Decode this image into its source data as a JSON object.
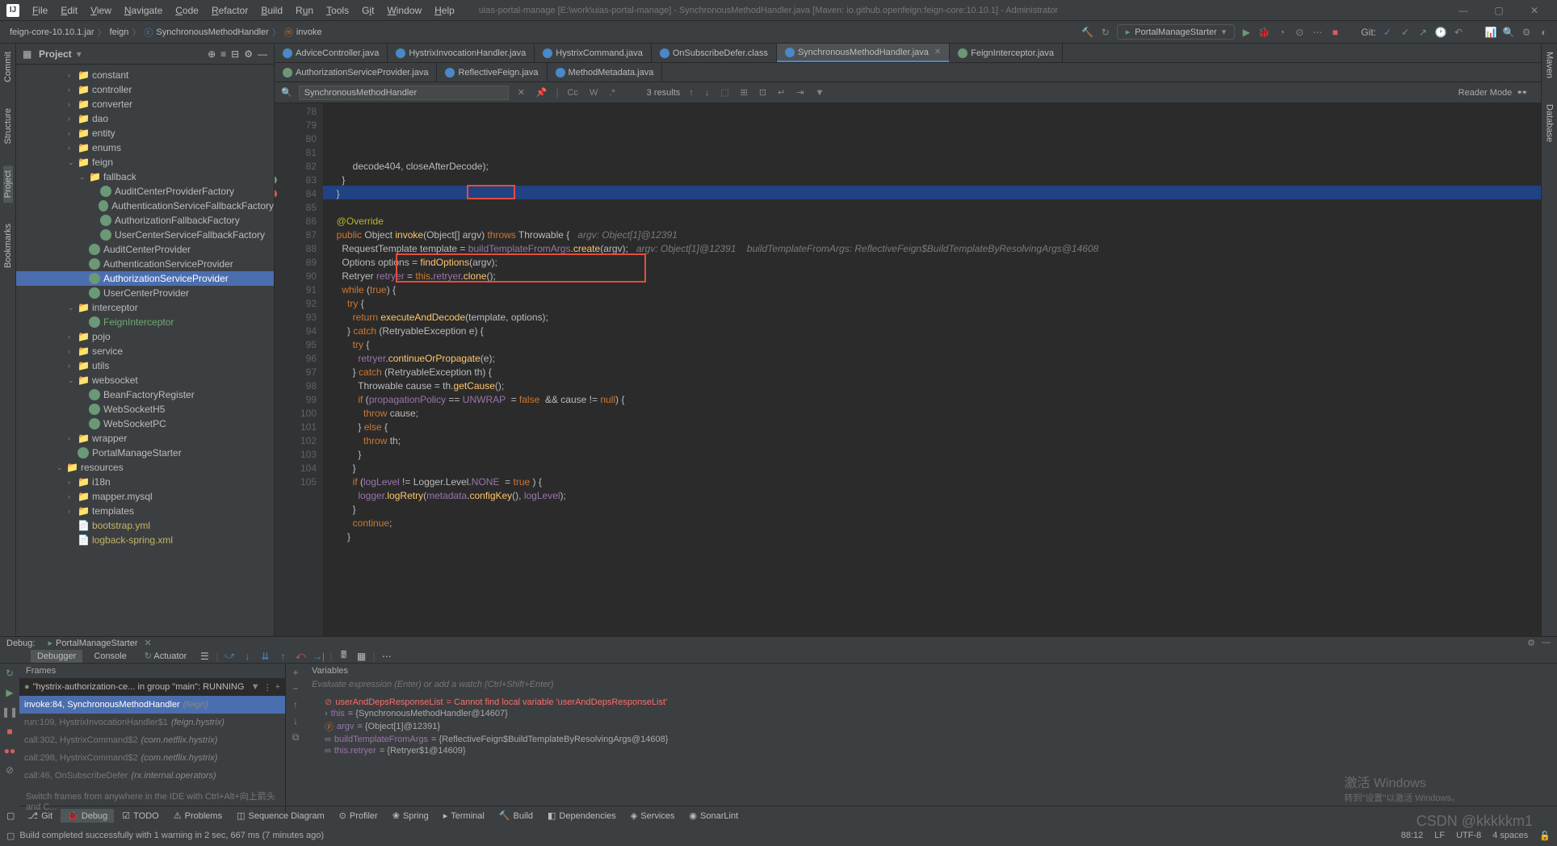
{
  "menubar": {
    "items": [
      "File",
      "Edit",
      "View",
      "Navigate",
      "Code",
      "Refactor",
      "Build",
      "Run",
      "Tools",
      "Git",
      "Window",
      "Help"
    ],
    "title": "uias-portal-manage [E:\\work\\uias-portal-manage] - SynchronousMethodHandler.java [Maven: io.github.openfeign:feign-core:10.10.1] - Administrator"
  },
  "navbar": {
    "crumbs": [
      "feign-core-10.10.1.jar",
      "feign",
      "SynchronousMethodHandler",
      "invoke"
    ],
    "runConfig": "PortalManageStarter",
    "gitLabel": "Git:"
  },
  "projectPanel": {
    "title": "Project",
    "tree": [
      {
        "d": 4,
        "a": ">",
        "i": "pkg",
        "l": "constant"
      },
      {
        "d": 4,
        "a": ">",
        "i": "pkg",
        "l": "controller"
      },
      {
        "d": 4,
        "a": ">",
        "i": "pkg",
        "l": "converter"
      },
      {
        "d": 4,
        "a": ">",
        "i": "pkg",
        "l": "dao"
      },
      {
        "d": 4,
        "a": ">",
        "i": "pkg",
        "l": "entity"
      },
      {
        "d": 4,
        "a": ">",
        "i": "pkg",
        "l": "enums"
      },
      {
        "d": 4,
        "a": "v",
        "i": "pkg",
        "l": "feign"
      },
      {
        "d": 5,
        "a": "v",
        "i": "pkg",
        "l": "fallback"
      },
      {
        "d": 6,
        "a": "",
        "i": "cls",
        "l": "AuditCenterProviderFactory"
      },
      {
        "d": 6,
        "a": "",
        "i": "cls",
        "l": "AuthenticationServiceFallbackFactory"
      },
      {
        "d": 6,
        "a": "",
        "i": "cls",
        "l": "AuthorizationFallbackFactory"
      },
      {
        "d": 6,
        "a": "",
        "i": "cls",
        "l": "UserCenterServiceFallbackFactory"
      },
      {
        "d": 5,
        "a": "",
        "i": "prov",
        "l": "AuditCenterProvider"
      },
      {
        "d": 5,
        "a": "",
        "i": "prov",
        "l": "AuthenticationServiceProvider"
      },
      {
        "d": 5,
        "a": "",
        "i": "prov",
        "l": "AuthorizationServiceProvider",
        "sel": true
      },
      {
        "d": 5,
        "a": "",
        "i": "prov",
        "l": "UserCenterProvider"
      },
      {
        "d": 4,
        "a": "v",
        "i": "pkg",
        "l": "interceptor"
      },
      {
        "d": 5,
        "a": "",
        "i": "cls",
        "l": "FeignInterceptor",
        "cls": "green"
      },
      {
        "d": 4,
        "a": ">",
        "i": "pkg",
        "l": "pojo"
      },
      {
        "d": 4,
        "a": ">",
        "i": "pkg",
        "l": "service"
      },
      {
        "d": 4,
        "a": ">",
        "i": "pkg",
        "l": "utils"
      },
      {
        "d": 4,
        "a": "v",
        "i": "pkg",
        "l": "websocket"
      },
      {
        "d": 5,
        "a": "",
        "i": "cls",
        "l": "BeanFactoryRegister"
      },
      {
        "d": 5,
        "a": "",
        "i": "cls",
        "l": "WebSocketH5"
      },
      {
        "d": 5,
        "a": "",
        "i": "cls",
        "l": "WebSocketPC"
      },
      {
        "d": 4,
        "a": ">",
        "i": "pkg",
        "l": "wrapper"
      },
      {
        "d": 4,
        "a": "",
        "i": "cls",
        "l": "PortalManageStarter"
      },
      {
        "d": 3,
        "a": "v",
        "i": "pkg",
        "l": "resources"
      },
      {
        "d": 4,
        "a": ">",
        "i": "pkg",
        "l": "i18n"
      },
      {
        "d": 4,
        "a": ">",
        "i": "pkg",
        "l": "mapper.mysql"
      },
      {
        "d": 4,
        "a": ">",
        "i": "pkg",
        "l": "templates"
      },
      {
        "d": 4,
        "a": "",
        "i": "file",
        "l": "bootstrap.yml",
        "cls": "yellow"
      },
      {
        "d": 4,
        "a": "",
        "i": "file",
        "l": "logback-spring.xml",
        "cls": "yellow"
      }
    ]
  },
  "editor": {
    "tabs1": [
      {
        "l": "AdviceController.java",
        "i": "b"
      },
      {
        "l": "HystrixInvocationHandler.java",
        "i": "b"
      },
      {
        "l": "HystrixCommand.java",
        "i": "b"
      },
      {
        "l": "OnSubscribeDefer.class",
        "i": "b"
      },
      {
        "l": "SynchronousMethodHandler.java",
        "i": "b",
        "active": true,
        "close": true
      },
      {
        "l": "FeignInterceptor.java",
        "i": "g"
      }
    ],
    "tabs2": [
      {
        "l": "AuthorizationServiceProvider.java",
        "i": "g"
      },
      {
        "l": "ReflectiveFeign.java",
        "i": "b"
      },
      {
        "l": "MethodMetadata.java",
        "i": "b"
      }
    ],
    "search": {
      "query": "SynchronousMethodHandler",
      "results": "3 results"
    },
    "readerMode": "Reader Mode",
    "code": {
      "start": 78,
      "lines": [
        {
          "n": 78,
          "t": "        decode404, closeAfterDecode);"
        },
        {
          "n": 79,
          "t": "    }"
        },
        {
          "n": 80,
          "t": "  }"
        },
        {
          "n": 81,
          "t": ""
        },
        {
          "n": 82,
          "t": "  @Override",
          "ann": true
        },
        {
          "n": 83,
          "t": "  public Object invoke(Object[] argv) throws Throwable {",
          "hint": "argv: Object[1]@12391",
          "ov": true
        },
        {
          "n": 84,
          "t": "    RequestTemplate template = buildTemplateFromArgs.create(argv);",
          "hint": "argv: Object[1]@12391    buildTemplateFromArgs: ReflectiveFeign$BuildTemplateByResolvingArgs@14608",
          "hl": true,
          "bp": true
        },
        {
          "n": 85,
          "t": "    Options options = findOptions(argv);"
        },
        {
          "n": 86,
          "t": "    Retryer retryer = this.retryer.clone();"
        },
        {
          "n": 87,
          "t": "    while (true) {"
        },
        {
          "n": 88,
          "t": "      try {"
        },
        {
          "n": 89,
          "t": "        return executeAndDecode(template, options);"
        },
        {
          "n": 90,
          "t": "      } catch (RetryableException e) {"
        },
        {
          "n": 91,
          "t": "        try {"
        },
        {
          "n": 92,
          "t": "          retryer.continueOrPropagate(e);"
        },
        {
          "n": 93,
          "t": "        } catch (RetryableException th) {"
        },
        {
          "n": 94,
          "t": "          Throwable cause = th.getCause();"
        },
        {
          "n": 95,
          "t": "          if (propagationPolicy == UNWRAP  = false  && cause != null) {"
        },
        {
          "n": 96,
          "t": "            throw cause;"
        },
        {
          "n": 97,
          "t": "          } else {"
        },
        {
          "n": 98,
          "t": "            throw th;"
        },
        {
          "n": 99,
          "t": "          }"
        },
        {
          "n": 100,
          "t": "        }"
        },
        {
          "n": 101,
          "t": "        if (logLevel != Logger.Level.NONE  = true ) {"
        },
        {
          "n": 102,
          "t": "          logger.logRetry(metadata.configKey(), logLevel);"
        },
        {
          "n": 103,
          "t": "        }"
        },
        {
          "n": 104,
          "t": "        continue;"
        },
        {
          "n": 105,
          "t": "      }"
        }
      ]
    }
  },
  "debug": {
    "header": "Debug:",
    "tab": "PortalManageStarter",
    "tabs": [
      "Debugger",
      "Console",
      "Actuator"
    ],
    "framesHdr": "Frames",
    "varsHdr": "Variables",
    "thread": "\"hystrix-authorization-ce... in group \"main\": RUNNING",
    "frames": [
      {
        "l": "invoke:84, SynchronousMethodHandler",
        "it": "(feign)",
        "sel": true
      },
      {
        "l": "run:109, HystrixInvocationHandler$1",
        "it": "(feign.hystrix)"
      },
      {
        "l": "call:302, HystrixCommand$2",
        "it": "(com.netflix.hystrix)"
      },
      {
        "l": "call:298, HystrixCommand$2",
        "it": "(com.netflix.hystrix)"
      },
      {
        "l": "call:46, OnSubscribeDefer",
        "it": "(rx.internal.operators)"
      }
    ],
    "framesHint": "Switch frames from anywhere in the IDE with Ctrl+Alt+向上箭头 and C...",
    "evalPlaceholder": "Evaluate expression (Enter) or add a watch (Ctrl+Shift+Enter)",
    "vars": [
      {
        "ico": "!",
        "n": "userAndDepsResponseList",
        "v": "= Cannot find local variable 'userAndDepsResponseList'",
        "err": true
      },
      {
        "ico": ">",
        "n": "this",
        "v": "= {SynchronousMethodHandler@14607}"
      },
      {
        "ico": ">",
        "n": "argv",
        "v": "= {Object[1]@12391}",
        "p": true
      },
      {
        "ico": ">",
        "n": "buildTemplateFromArgs",
        "v": "= {ReflectiveFeign$BuildTemplateByResolvingArgs@14608}",
        "oo": true
      },
      {
        "ico": ">",
        "n": "this.retryer",
        "v": "= {Retryer$1@14609}",
        "oo": true
      }
    ]
  },
  "toolWindows": [
    {
      "l": "Git",
      "i": "⎇"
    },
    {
      "l": "Debug",
      "i": "🐞",
      "active": true
    },
    {
      "l": "TODO",
      "i": "☑"
    },
    {
      "l": "Problems",
      "i": "⚠"
    },
    {
      "l": "Sequence Diagram",
      "i": "◫"
    },
    {
      "l": "Profiler",
      "i": "⊙"
    },
    {
      "l": "Spring",
      "i": "❀"
    },
    {
      "l": "Terminal",
      "i": "▸"
    },
    {
      "l": "Build",
      "i": "🔨"
    },
    {
      "l": "Dependencies",
      "i": "◧"
    },
    {
      "l": "Services",
      "i": "◈"
    },
    {
      "l": "SonarLint",
      "i": "◉"
    }
  ],
  "statusBar": {
    "msg": "Build completed successfully with 1 warning in 2 sec, 667 ms (7 minutes ago)",
    "pos": "88:12",
    "enc": "LF",
    "cs": "UTF-8",
    "sp": "4 spaces"
  },
  "watermark": {
    "l1": "激活 Windows",
    "l2": "转到\"设置\"以激活 Windows。"
  },
  "csdn": "CSDN @kkkkkm1"
}
